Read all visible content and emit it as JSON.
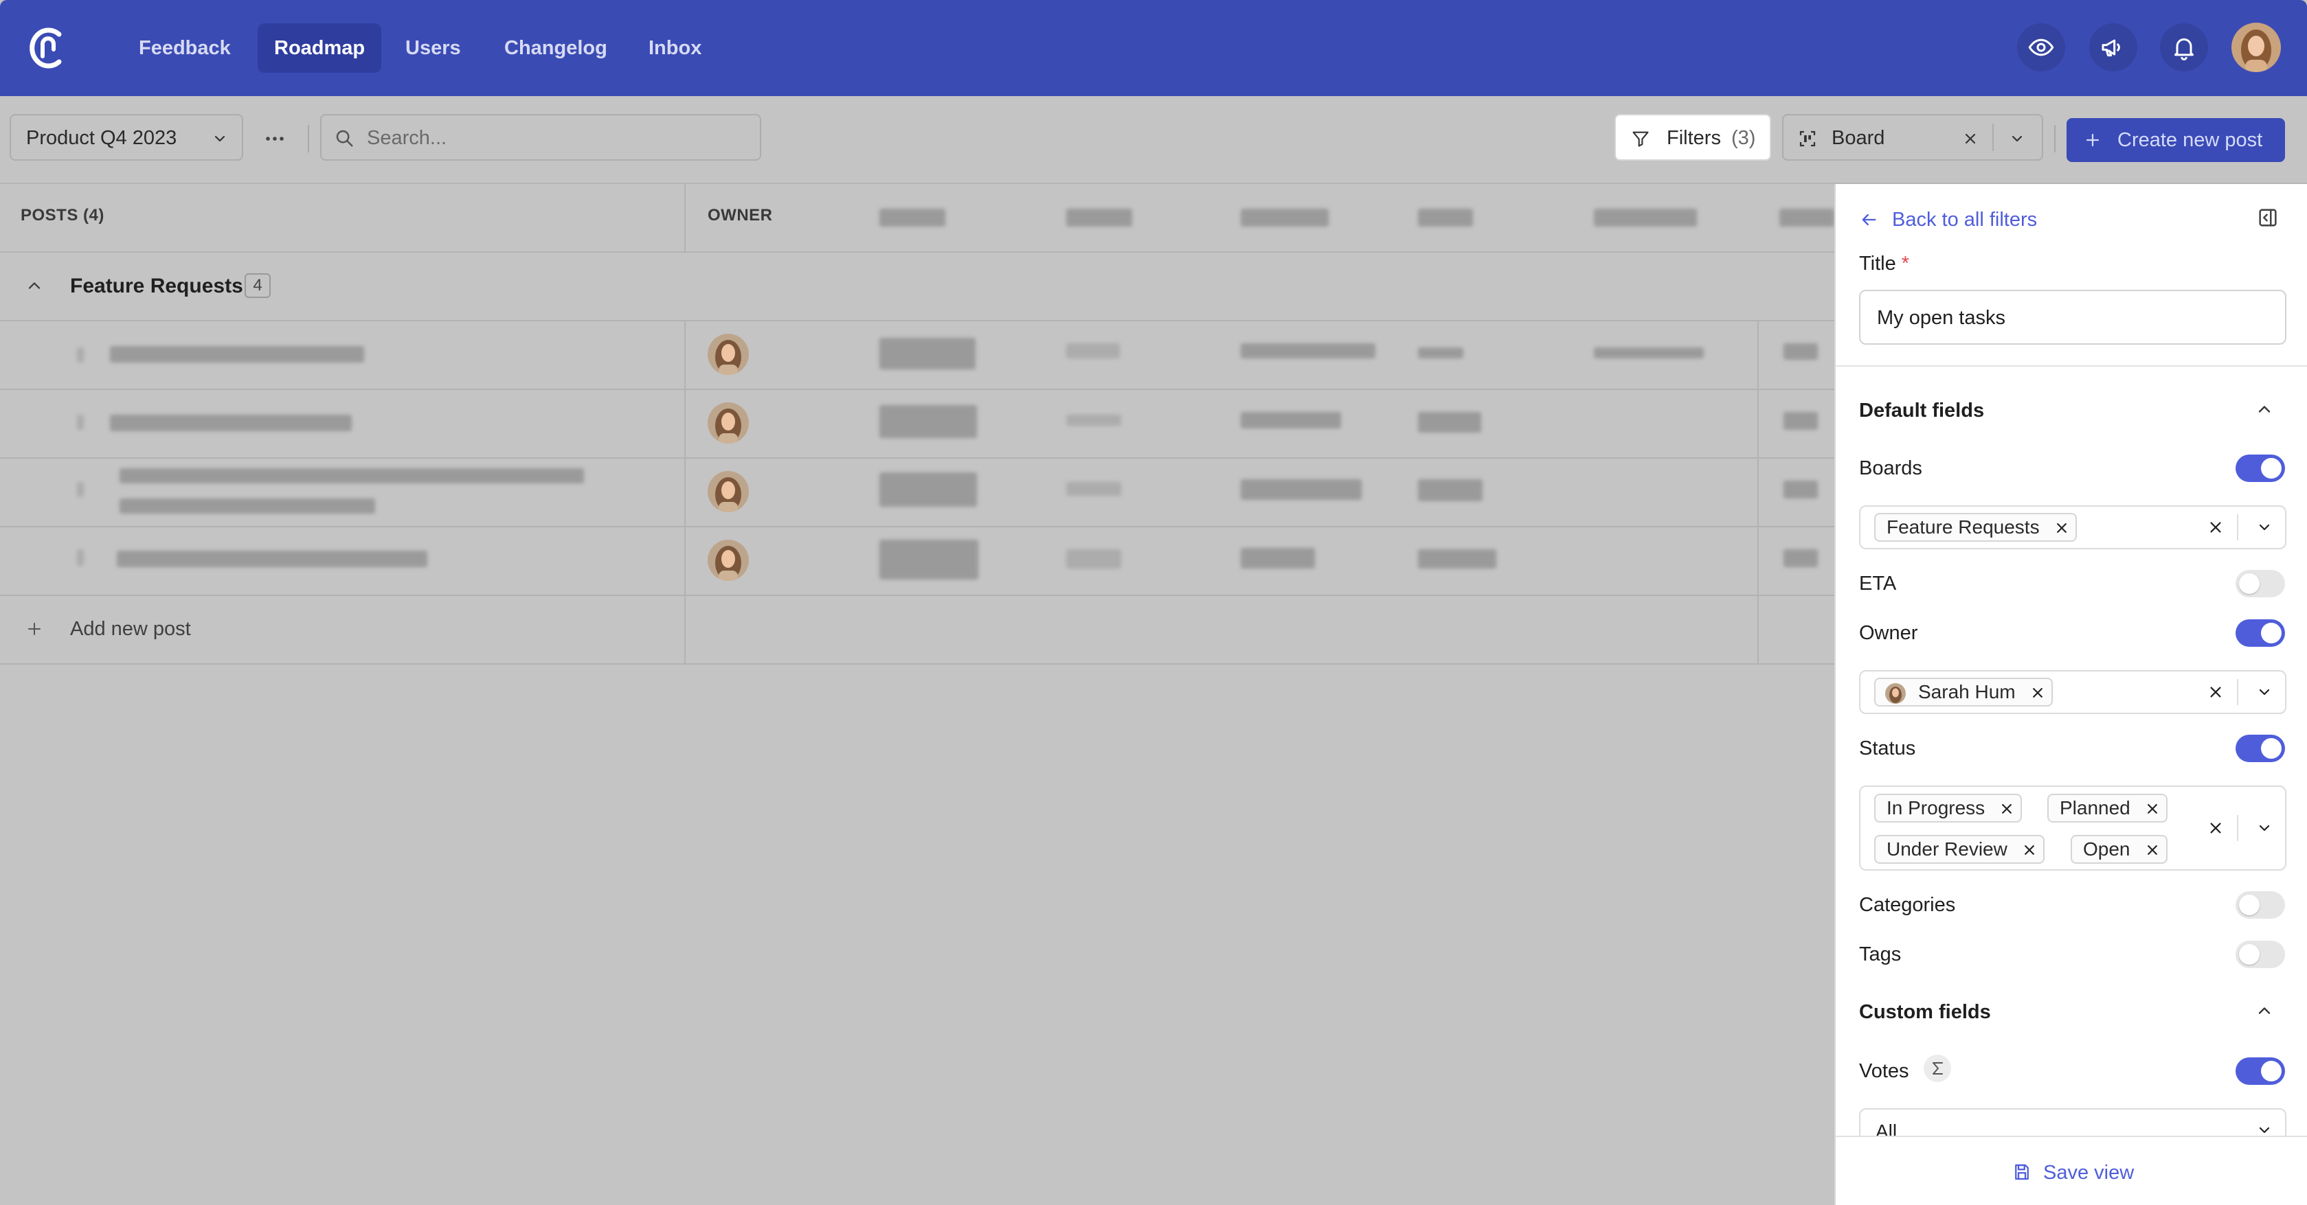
{
  "nav": {
    "items": [
      "Feedback",
      "Roadmap",
      "Users",
      "Changelog",
      "Inbox"
    ],
    "active": "Roadmap",
    "icons": [
      "eye-icon",
      "megaphone-icon",
      "bell-icon"
    ],
    "accent_color": "#3b4bb4"
  },
  "toolbar": {
    "roadmap_select": "Product Q4 2023",
    "search_placeholder": "Search...",
    "filters_label": "Filters",
    "filters_count": "(3)",
    "view_select": "Board",
    "create_label": "Create new post",
    "create_color": "#4f5ddb"
  },
  "table": {
    "posts_header": "POSTS (4)",
    "owner_header": "OWNER",
    "group_name": "Feature Requests",
    "group_count": "4",
    "add_post": "Add new post"
  },
  "panel": {
    "back_label": "Back to all filters",
    "title_label": "Title",
    "required_mark": "*",
    "title_value": "My open tasks",
    "default_fields": "Default fields",
    "boards_label": "Boards",
    "boards_enabled": true,
    "boards_chips": [
      "Feature Requests"
    ],
    "eta_label": "ETA",
    "eta_enabled": false,
    "owner_label": "Owner",
    "owner_enabled": true,
    "owner_chip": "Sarah Hum",
    "status_label": "Status",
    "status_enabled": true,
    "status_chips": [
      "In Progress",
      "Planned",
      "Under Review",
      "Open"
    ],
    "categories_label": "Categories",
    "categories_enabled": false,
    "tags_label": "Tags",
    "tags_enabled": false,
    "custom_fields": "Custom fields",
    "votes_label": "Votes",
    "votes_enabled": true,
    "votes_select": "All",
    "save_label": "Save view"
  }
}
